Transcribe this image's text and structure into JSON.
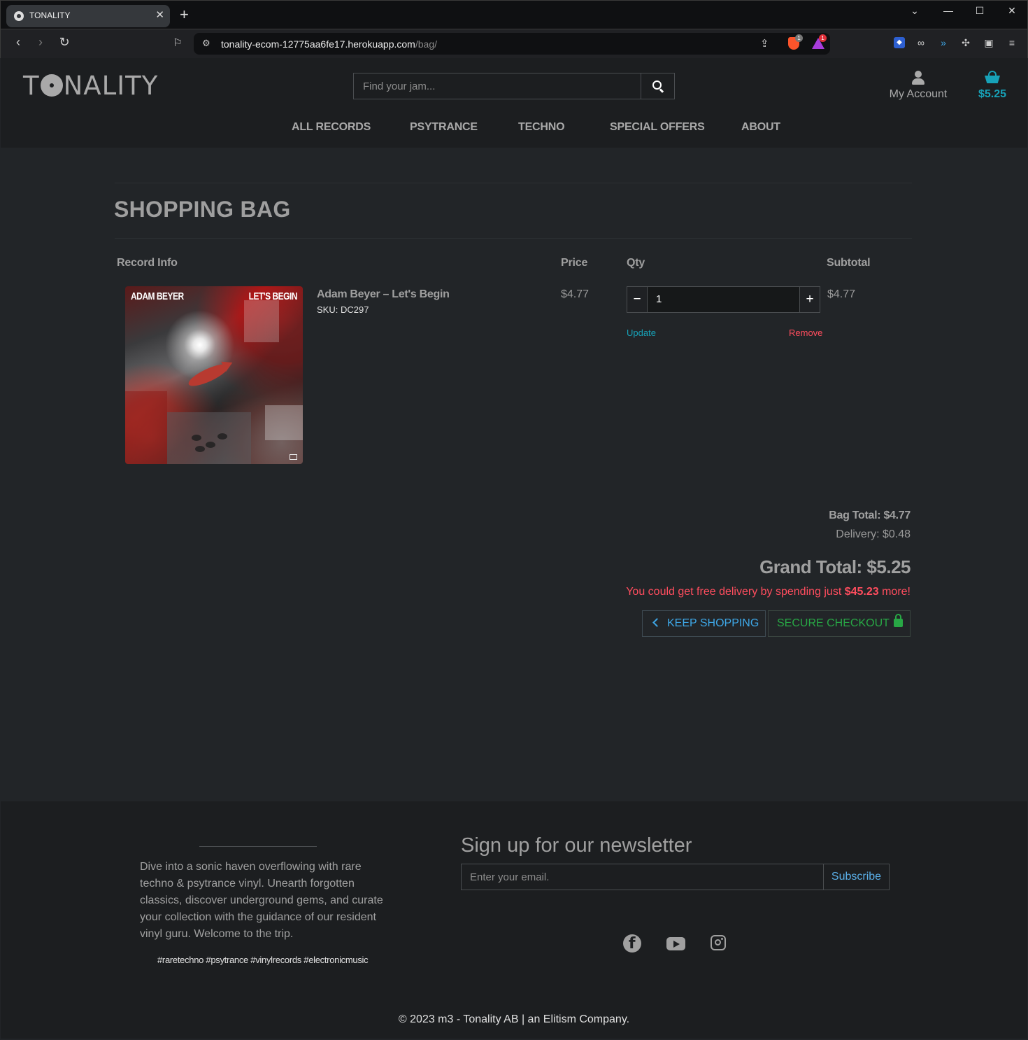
{
  "browser": {
    "tab_title": "TONALITY",
    "url_host": "tonality-ecom-12775aa6fe17.herokuapp.com",
    "url_path": "/bag/",
    "brave_badge": "1",
    "rewards_badge": "1"
  },
  "header": {
    "logo_left": "T",
    "logo_right": "NALITY",
    "search_placeholder": "Find your jam...",
    "account_label": "My Account",
    "bag_amount": "$5.25",
    "nav": [
      "ALL RECORDS",
      "PSYTRANCE",
      "TECHNO",
      "SPECIAL OFFERS",
      "ABOUT"
    ]
  },
  "bag": {
    "title": "SHOPPING BAG",
    "columns": [
      "Record Info",
      "Price",
      "Qty",
      "Subtotal"
    ],
    "items": [
      {
        "cover_artist": "ADAM BEYER",
        "cover_title": "LET'S BEGIN",
        "name": "Adam Beyer – Let's Begin",
        "sku": "SKU: DC297",
        "price": "$4.77",
        "qty": "1",
        "subtotal": "$4.77",
        "update_label": "Update",
        "remove_label": "Remove"
      }
    ],
    "bag_total": "Bag Total: $4.77",
    "delivery": "Delivery: $0.48",
    "grand_total": "Grand Total: $5.25",
    "free_delivery_prefix": "You could get free delivery by spending just ",
    "free_delivery_amount": "$45.23",
    "free_delivery_suffix": " more!",
    "keep_shopping": "KEEP SHOPPING",
    "secure_checkout": "SECURE CHECKOUT"
  },
  "footer": {
    "about": "Dive into a sonic haven overflowing with rare techno & psytrance vinyl. Unearth forgotten classics, discover underground gems, and curate your collection with the guidance of our resident vinyl guru. Welcome to the trip.",
    "tags": "#raretechno #psytrance #vinylrecords #electronicmusic",
    "newsletter_title": "Sign up for our newsletter",
    "email_placeholder": "Enter your email.",
    "subscribe_label": "Subscribe",
    "social_icons": [
      "facebook-icon",
      "youtube-icon",
      "instagram-icon"
    ],
    "copyright": "© 2023 m3 - Tonality AB | an Elitism Company."
  },
  "colors": {
    "accent": "#17a2b8",
    "danger": "#ff4d5e",
    "success": "#28a745",
    "background": "#222528"
  }
}
